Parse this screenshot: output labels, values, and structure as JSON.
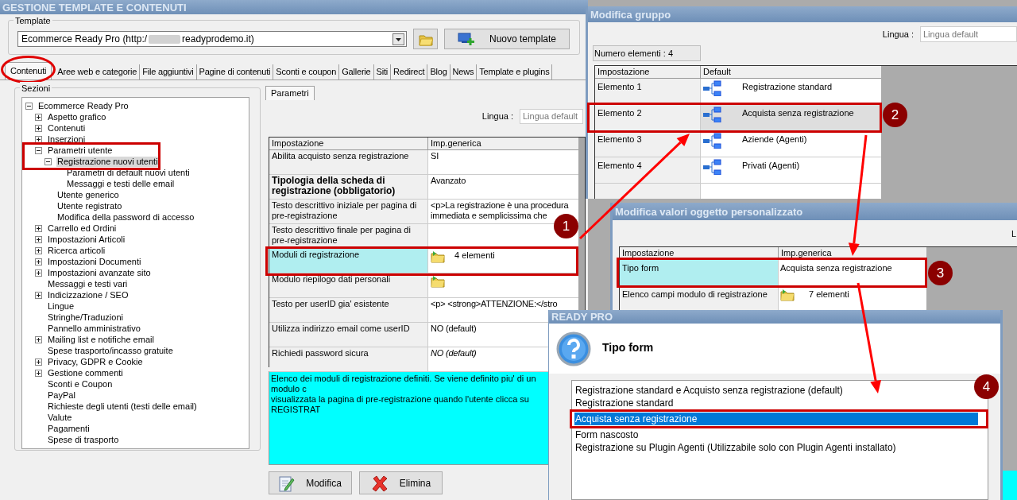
{
  "main_window": {
    "title": "GESTIONE TEMPLATE E CONTENUTI",
    "template": {
      "label": "Template",
      "value_start": "Ecommerce Ready Pro (http:/",
      "value_end": "readyprodemo.it)",
      "new_button": "Nuovo template"
    },
    "tabs": [
      {
        "label": "Contenuti",
        "selected": true,
        "circled": true
      },
      {
        "label": "Aree web e categorie",
        "selected": false
      },
      {
        "label": "File aggiuntivi",
        "selected": false
      },
      {
        "label": "Pagine di contenuti",
        "selected": false
      },
      {
        "label": "Sconti e coupon",
        "selected": false
      },
      {
        "label": "Gallerie",
        "selected": false
      },
      {
        "label": "Siti",
        "selected": false
      },
      {
        "label": "Redirect",
        "selected": false
      },
      {
        "label": "Blog",
        "selected": false
      },
      {
        "label": "News",
        "selected": false
      },
      {
        "label": "Template e plugins",
        "selected": false
      }
    ],
    "sections": {
      "label": "Sezioni",
      "tree": [
        {
          "label": "Ecommerce Ready Pro",
          "expanded": true,
          "selected": false,
          "children": [
            {
              "label": "Aspetto grafico",
              "expanded": false,
              "selected": false
            },
            {
              "label": "Contenuti",
              "expanded": false,
              "selected": false
            },
            {
              "label": "Inserzioni",
              "expanded": false,
              "selected": false
            },
            {
              "label": "Parametri utente",
              "expanded": true,
              "selected": false,
              "framed": true,
              "children": [
                {
                  "label": "Registrazione nuovi utenti",
                  "expanded": true,
                  "selected": true,
                  "children": [
                    {
                      "label": "Parametri di default nuovi utenti",
                      "selected": false
                    },
                    {
                      "label": "Messaggi e testi delle email",
                      "selected": false
                    }
                  ]
                },
                {
                  "label": "Utente generico",
                  "selected": false
                },
                {
                  "label": "Utente registrato",
                  "selected": false
                },
                {
                  "label": "Modifica della password di accesso",
                  "selected": false
                }
              ]
            },
            {
              "label": "Carrello ed Ordini",
              "expanded": false,
              "selected": false
            },
            {
              "label": "Impostazioni Articoli",
              "expanded": false,
              "selected": false
            },
            {
              "label": "Ricerca articoli",
              "expanded": false,
              "selected": false
            },
            {
              "label": "Impostazioni Documenti",
              "expanded": false,
              "selected": false
            },
            {
              "label": "Impostazioni avanzate sito",
              "expanded": false,
              "selected": false
            },
            {
              "label": "Messaggi e testi vari",
              "selected": false
            },
            {
              "label": "Indicizzazione / SEO",
              "expanded": false,
              "selected": false
            },
            {
              "label": "Lingue",
              "selected": false
            },
            {
              "label": "Stringhe/Traduzioni",
              "selected": false
            },
            {
              "label": "Pannello amministrativo",
              "selected": false
            },
            {
              "label": "Mailing list e notifiche email",
              "expanded": false,
              "selected": false
            },
            {
              "label": "Spese trasporto/incasso gratuite",
              "selected": false
            },
            {
              "label": "Privacy, GDPR e Cookie",
              "expanded": false,
              "selected": false
            },
            {
              "label": "Gestione commenti",
              "expanded": false,
              "selected": false
            },
            {
              "label": "Sconti e Coupon",
              "selected": false
            },
            {
              "label": "PayPal",
              "selected": false
            },
            {
              "label": "Richieste degli utenti (testi delle email)",
              "selected": false
            },
            {
              "label": "Valute",
              "selected": false
            },
            {
              "label": "Pagamenti",
              "selected": false
            },
            {
              "label": "Spese di trasporto",
              "selected": false
            }
          ]
        }
      ]
    },
    "panel_tab": "Parametri",
    "language": {
      "label": "Lingua :",
      "placeholder": "Lingua default"
    },
    "table": {
      "columns": [
        "Impostazione",
        "Imp.generica"
      ],
      "rows": [
        {
          "setting": "Abilita acquisto senza registrazione",
          "value": "SI",
          "kind": "text",
          "selected": false
        },
        {
          "setting": "Tipologia della scheda di registrazione (obbligatorio)",
          "value": "Avanzato",
          "kind": "text",
          "bold": true,
          "selected": false
        },
        {
          "setting": "Testo descrittivo iniziale per pagina di pre-registrazione",
          "value": "<p>La registrazione è una procedura immediata e semplicissima che",
          "kind": "text",
          "selected": false
        },
        {
          "setting": "Testo descrittivo finale per pagina di pre-registrazione",
          "kind": "text",
          "selected": false
        },
        {
          "setting": "Moduli di registrazione",
          "value": "4 elementi",
          "kind": "group",
          "selected": true,
          "framed": true
        },
        {
          "setting": "Modulo riepilogo dati personali",
          "kind": "group",
          "selected": false
        },
        {
          "setting": "Testo per userID gia' esistente",
          "value": "<p> <strong>ATTENZIONE:</stro",
          "kind": "text",
          "selected": false
        },
        {
          "setting": "Utilizza indirizzo email come userID",
          "value": "NO (default)",
          "kind": "text",
          "selected": false
        },
        {
          "setting": "Richiedi password sicura",
          "value": "NO (default)",
          "kind": "text",
          "italic": true,
          "selected": false
        }
      ]
    },
    "description": [
      "Elenco dei moduli di registrazione definiti. Se viene definito piu' di un modulo c",
      "visualizzata la pagina di pre-registrazione quando l'utente clicca su REGISTRAT"
    ],
    "buttons": [
      {
        "label": "Modifica",
        "kind": "edit"
      },
      {
        "label": "Elimina",
        "kind": "delete"
      }
    ]
  },
  "group_window": {
    "title": "Modifica gruppo",
    "language": {
      "label": "Lingua :",
      "placeholder": "Lingua default"
    },
    "count": "Numero elementi : 4",
    "table": {
      "columns": [
        "Impostazione",
        "Default"
      ],
      "rows": [
        {
          "setting": "Elemento 1",
          "value": "Registrazione standard",
          "selected": false
        },
        {
          "setting": "Elemento 2",
          "value": "Acquista senza registrazione",
          "selected": true,
          "framed": true
        },
        {
          "setting": "Elemento 3",
          "value": "Aziende (Agenti)",
          "selected": false
        },
        {
          "setting": "Elemento 4",
          "value": "Privati (Agenti)",
          "selected": false
        }
      ]
    }
  },
  "object_window": {
    "title": "Modifica valori oggetto personalizzato",
    "language_label": "L",
    "table": {
      "columns": [
        "Impostazione",
        "Imp.generica"
      ],
      "rows": [
        {
          "setting": "Tipo form",
          "value": "Acquista senza registrazione",
          "kind": "text",
          "selected": true,
          "framed": true
        },
        {
          "setting": "Elenco campi modulo di registrazione",
          "value": "7 elementi",
          "kind": "group",
          "selected": false
        }
      ]
    }
  },
  "dialog": {
    "title": "READY PRO",
    "heading": "Tipo form",
    "options": [
      {
        "label": "Registrazione standard e Acquisto senza registrazione (default)",
        "selected": false
      },
      {
        "label": "Registrazione standard",
        "selected": false
      },
      {
        "label": "Acquista senza registrazione",
        "selected": true,
        "framed": true
      },
      {
        "label": "Form nascosto",
        "selected": false
      },
      {
        "label": "Registrazione su Plugin Agenti (Utilizzabile solo con Plugin Agenti installato)",
        "selected": false
      }
    ]
  },
  "annotations": [
    {
      "number": "1"
    },
    {
      "number": "2"
    },
    {
      "number": "3"
    },
    {
      "number": "4"
    }
  ]
}
